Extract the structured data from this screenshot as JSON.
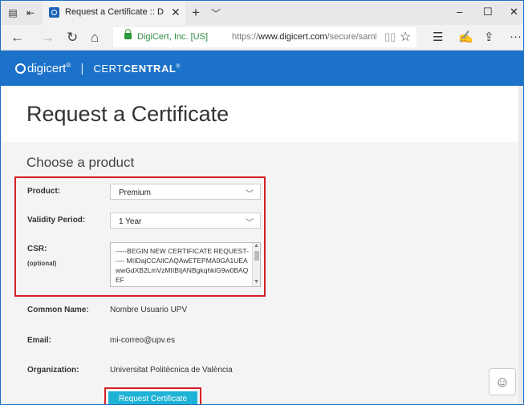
{
  "browser": {
    "tab_title": "Request a Certificate :: D",
    "tab_close": "✕",
    "new_tab": "+",
    "tab_list": "﹀",
    "win_min": "–",
    "win_max": "☐",
    "win_close": "✕",
    "back": "←",
    "forward": "→",
    "refresh": "↻",
    "home": "⌂",
    "url_owner": "DigiCert, Inc. [US]",
    "url_prefix": "https://",
    "url_host": "www.digicert.com",
    "url_path": "/secure/saml/requests/",
    "favorites": "☆",
    "hub": "☰",
    "notes": "✍",
    "share": "⇪",
    "more": "···"
  },
  "header": {
    "brand": "digicert",
    "brand_mark": "®",
    "separator": "|",
    "product_light": "CERT",
    "product_bold": "CENTRAL",
    "product_mark": "®"
  },
  "page": {
    "title": "Request a Certificate",
    "section_title": "Choose a product"
  },
  "form": {
    "product_label": "Product:",
    "product_value": "Premium",
    "validity_label": "Validity Period:",
    "validity_value": "1 Year",
    "csr_label": "CSR:",
    "csr_sublabel": "(optional)",
    "csr_text": "-----BEGIN NEW CERTIFICATE REQUEST-----\nMIIDajCCAlICAQAwETEPMA0GA1UEAwwGdXB2LmVzMIIBIjANBgkqhkiG9w0BAQEF",
    "common_name_label": "Common Name:",
    "common_name_value": "Nombre Usuario UPV",
    "email_label": "Email:",
    "email_value": "mi-correo@upv.es",
    "org_label": "Organization:",
    "org_value": "Universitat Politècnica de València",
    "submit_label": "Request Certificate",
    "chevron": "﹀"
  },
  "feedback_icon": "☺",
  "colors": {
    "header": "#1b72c8",
    "highlight": "#d61f26",
    "button": "#1eb3d6"
  }
}
